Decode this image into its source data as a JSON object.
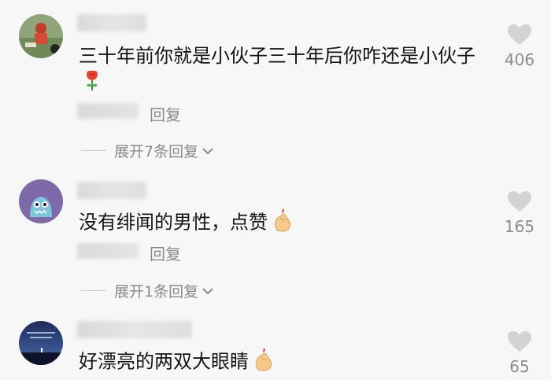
{
  "comments": [
    {
      "text": "三十年前你就是小伙子三十年后你咋还是小伙子",
      "reply_label": "回复",
      "expand_label": "展开7条回复",
      "like_count": "406",
      "emoji": "rose-icon"
    },
    {
      "text": "没有绯闻的男性，点赞",
      "reply_label": "回复",
      "expand_label": "展开1条回复",
      "like_count": "165",
      "emoji": "finger-heart-icon"
    },
    {
      "text": "好漂亮的两双大眼睛",
      "like_count": "65",
      "emoji": "finger-heart-icon"
    }
  ],
  "colors": {
    "background": "#f7f7f7",
    "text": "#151515",
    "secondary": "#8a8a8a",
    "heart": "#d3d3d3"
  }
}
